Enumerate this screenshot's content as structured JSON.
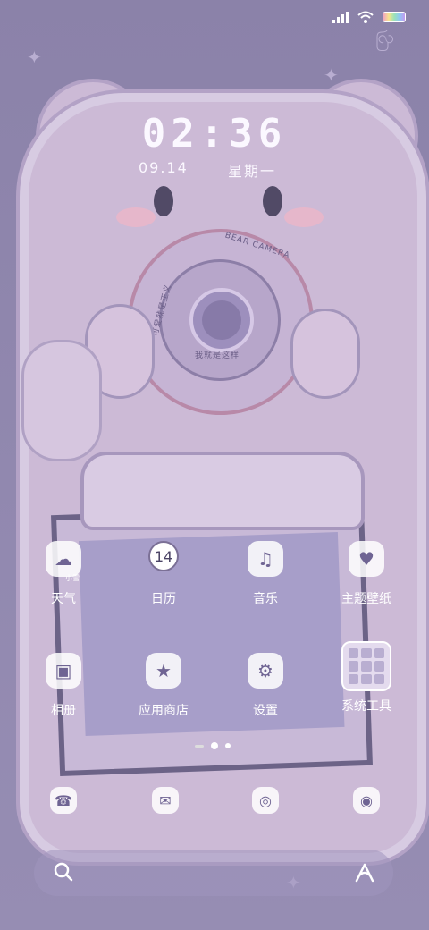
{
  "status": {
    "icons": [
      "signal-icon",
      "wifi-icon",
      "battery-icon"
    ]
  },
  "clock": {
    "time": "02:36",
    "date": "09.14",
    "weekday": "星期一"
  },
  "wallpaper": {
    "camera_top": "BEAR CAMERA",
    "camera_left": "可爱就是正义",
    "camera_bottom": "我就是这样"
  },
  "apps_row1": [
    {
      "label": "天气",
      "icon": "weather-icon",
      "sub": "小雪"
    },
    {
      "label": "日历",
      "icon": "calendar-icon",
      "day": "14"
    },
    {
      "label": "音乐",
      "icon": "music-icon"
    },
    {
      "label": "主题壁纸",
      "icon": "theme-icon"
    }
  ],
  "apps_row2": [
    {
      "label": "相册",
      "icon": "gallery-icon"
    },
    {
      "label": "应用商店",
      "icon": "app-store-icon"
    },
    {
      "label": "设置",
      "icon": "settings-icon"
    },
    {
      "label": "系统工具",
      "icon": "folder-icon"
    }
  ],
  "dock": [
    {
      "icon": "phone-icon"
    },
    {
      "icon": "messages-icon"
    },
    {
      "icon": "browser-icon"
    },
    {
      "icon": "camera-icon"
    }
  ],
  "page_indicator": {
    "pages": 3,
    "current": 1
  },
  "colors": {
    "wallpaper": "#8c83aa",
    "bear": "#ccbad6",
    "outline": "#b3a2c6"
  }
}
